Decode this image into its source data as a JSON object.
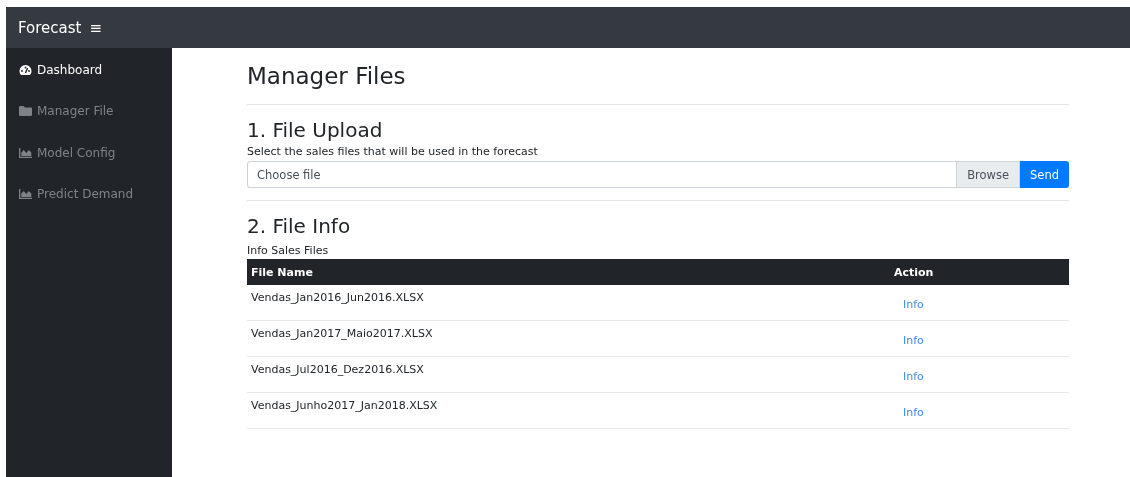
{
  "navbar": {
    "brand": "Forecast",
    "menu_icon": "≡"
  },
  "sidebar": {
    "items": [
      {
        "label": "Dashboard",
        "kind": "gauge",
        "selected": true
      },
      {
        "label": "Manager File",
        "kind": "folder",
        "selected": false
      },
      {
        "label": "Model Config",
        "kind": "chart",
        "selected": false
      },
      {
        "label": "Predict Demand",
        "kind": "chart",
        "selected": false
      }
    ]
  },
  "page": {
    "title": "Manager Files",
    "upload": {
      "heading": "1. File Upload",
      "description": "Select the sales files that will be used in the forecast",
      "placeholder": "Choose file",
      "browse": "Browse",
      "send": "Send"
    },
    "info": {
      "heading": "2. File Info",
      "caption": "Info Sales Files",
      "table": {
        "columns": [
          "File Name",
          "Action"
        ],
        "rows": [
          {
            "file_name": "Vendas_Jan2016_Jun2016.XLSX",
            "action": "Info"
          },
          {
            "file_name": "Vendas_Jan2017_Maio2017.XLSX",
            "action": "Info"
          },
          {
            "file_name": "Vendas_Jul2016_Dez2016.XLSX",
            "action": "Info"
          },
          {
            "file_name": "Vendas_Junho2017_Jan2018.XLSX",
            "action": "Info"
          }
        ]
      }
    }
  }
}
